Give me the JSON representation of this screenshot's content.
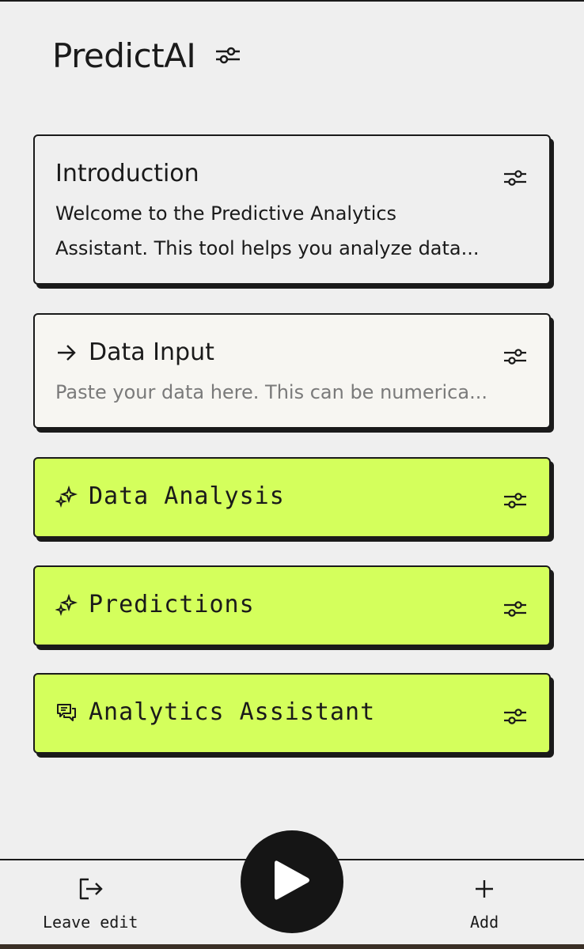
{
  "app": {
    "title": "PredictAI"
  },
  "cards": [
    {
      "title": "Introduction",
      "lines": [
        "Welcome to the Predictive Analytics",
        "Assistant. This tool helps you analyze data..."
      ]
    },
    {
      "title": "Data Input",
      "placeholder": "Paste your data here. This can be numerica..."
    },
    {
      "title": "Data Analysis"
    },
    {
      "title": "Predictions"
    },
    {
      "title": "Analytics Assistant"
    }
  ],
  "bottom_nav": {
    "leave_label": "Leave edit",
    "add_label": "Add"
  },
  "colors": {
    "background": "#efefef",
    "lime": "#d4ff5c",
    "cream": "#f7f6f2",
    "dark": "#151515"
  },
  "icons": {
    "header": "tune-icon",
    "input": "arrow-right-icon",
    "analysis": "sparkle-icon",
    "predictions": "sparkle-icon",
    "assistant": "chat-icon",
    "leave": "logout-icon",
    "add": "plus-icon",
    "play": "play-icon"
  }
}
